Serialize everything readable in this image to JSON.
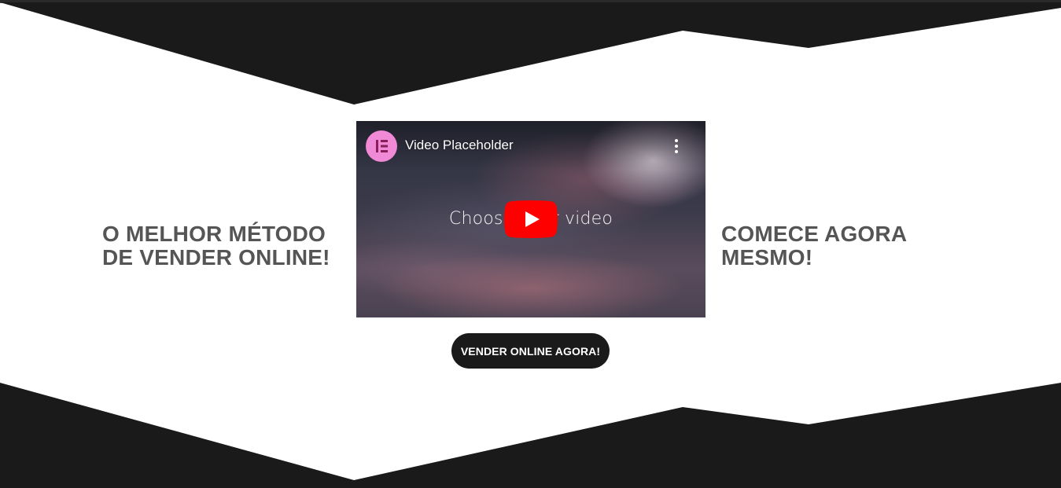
{
  "colors": {
    "dark_band": "#1b1a1b",
    "headline_text": "#555555",
    "button_bg": "#1a1a1a",
    "button_text": "#ffffff",
    "avatar_bg": "#f08ad6",
    "youtube_red": "#ff0000"
  },
  "hero": {
    "left_headline": "O MELHOR MÉTODO\nDE VENDER ONLINE!",
    "right_headline": "COMECE AGORA\nMESMO!"
  },
  "video": {
    "title": "Video Placeholder",
    "center_text": "Choose your video",
    "channel_icon": "elementor-logo-icon",
    "menu_icon": "more-vertical-icon",
    "play_icon": "youtube-play-icon"
  },
  "cta": {
    "label": "VENDER ONLINE AGORA!"
  }
}
